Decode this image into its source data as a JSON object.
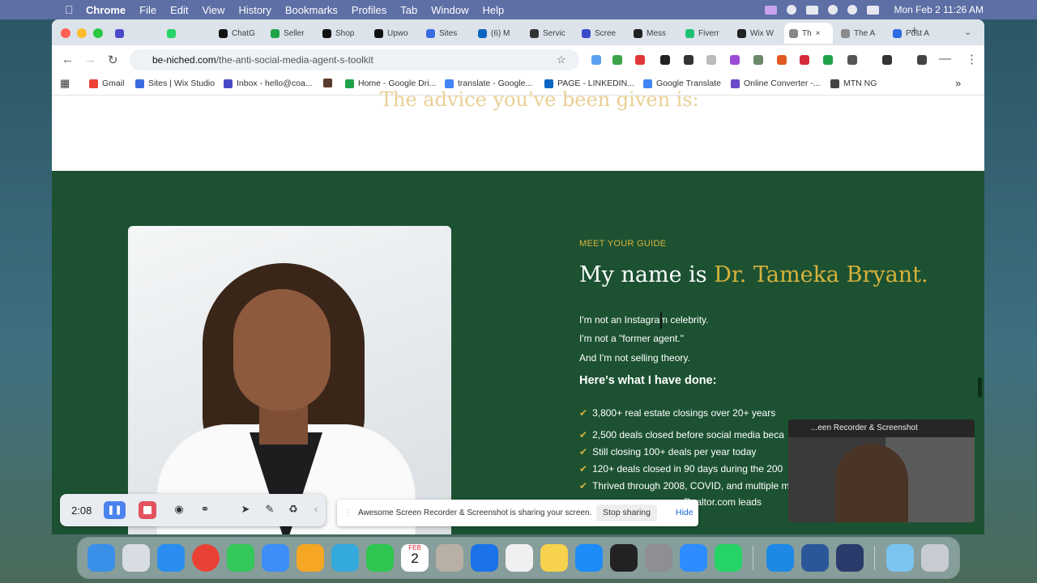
{
  "menubar": {
    "app": "Chrome",
    "items": [
      "File",
      "Edit",
      "View",
      "History",
      "Bookmarks",
      "Profiles",
      "Tab",
      "Window",
      "Help"
    ],
    "clock": "Mon Feb 2  11:26 AM"
  },
  "browser": {
    "tabs": [
      {
        "label": "",
        "color": "#4a4ac8"
      },
      {
        "label": "",
        "color": "#25d366"
      },
      {
        "label": "ChatG",
        "color": "#111111"
      },
      {
        "label": "Seller",
        "color": "#1fa34a"
      },
      {
        "label": "Shop",
        "color": "#111111"
      },
      {
        "label": "Upwo",
        "color": "#111111"
      },
      {
        "label": "Sites",
        "color": "#3b6be0"
      },
      {
        "label": "(6) M",
        "color": "#0a66c2"
      },
      {
        "label": "Servic",
        "color": "#333333"
      },
      {
        "label": "Scree",
        "color": "#3b4ac8"
      },
      {
        "label": "Mess",
        "color": "#222222"
      },
      {
        "label": "Fiverr",
        "color": "#1dbf73"
      },
      {
        "label": "Wix W",
        "color": "#222222"
      },
      {
        "label": "Th",
        "color": "#888888"
      },
      {
        "label": "The A",
        "color": "#8a8a8a"
      },
      {
        "label": "Post A",
        "color": "#2d6cdf"
      }
    ],
    "url_host": "be-niched.com",
    "url_path": "/the-anti-social-media-agent-s-toolkit",
    "bookmarks": [
      {
        "label": "Gmail",
        "color": "#ea4335"
      },
      {
        "label": "Sites | Wix Studio",
        "color": "#3b6be0"
      },
      {
        "label": "Inbox - hello@coa...",
        "color": "#4a4ac8"
      },
      {
        "label": "",
        "color": "#5a3a2a"
      },
      {
        "label": "Home - Google Dri...",
        "color": "#1fa34a"
      },
      {
        "label": "translate - Google...",
        "color": "#4285f4"
      },
      {
        "label": "PAGE - LINKEDIN...",
        "color": "#0a66c2"
      },
      {
        "label": "Google Translate",
        "color": "#4285f4"
      },
      {
        "label": "Online Converter -...",
        "color": "#6a4ac8"
      },
      {
        "label": "MTN NG",
        "color": "#444444"
      }
    ]
  },
  "page": {
    "ghost_heading": "The advice you've been given is:",
    "meet_label": "MEET YOUR GUIDE",
    "name_prefix": "My name is ",
    "name_highlight": "Dr. Tameka Bryant.",
    "intro_lines": [
      "I'm not an Instagram celebrity.",
      "I'm not a \"former agent.\"",
      "And I'm not selling theory."
    ],
    "done_heading": "Here's what I have done:",
    "achievements": [
      "3,800+ real estate closings over 20+ years",
      "2,500 deals closed before social media beca",
      "Still closing 100+ deals per year today",
      "120+ deals closed in 90 days during the 200",
      "Thrived through 2008, COVID, and multiple m",
      "Realtor.com leads"
    ]
  },
  "overlays": {
    "recorder_time": "2:08",
    "share_message": "Awesome Screen Recorder & Screenshot is sharing your screen.",
    "stop_sharing": "Stop sharing",
    "hide": "Hide",
    "camera_title": "...een Recorder & Screenshot"
  },
  "dock": {
    "calendar_month": "FEB",
    "calendar_day": "2"
  }
}
